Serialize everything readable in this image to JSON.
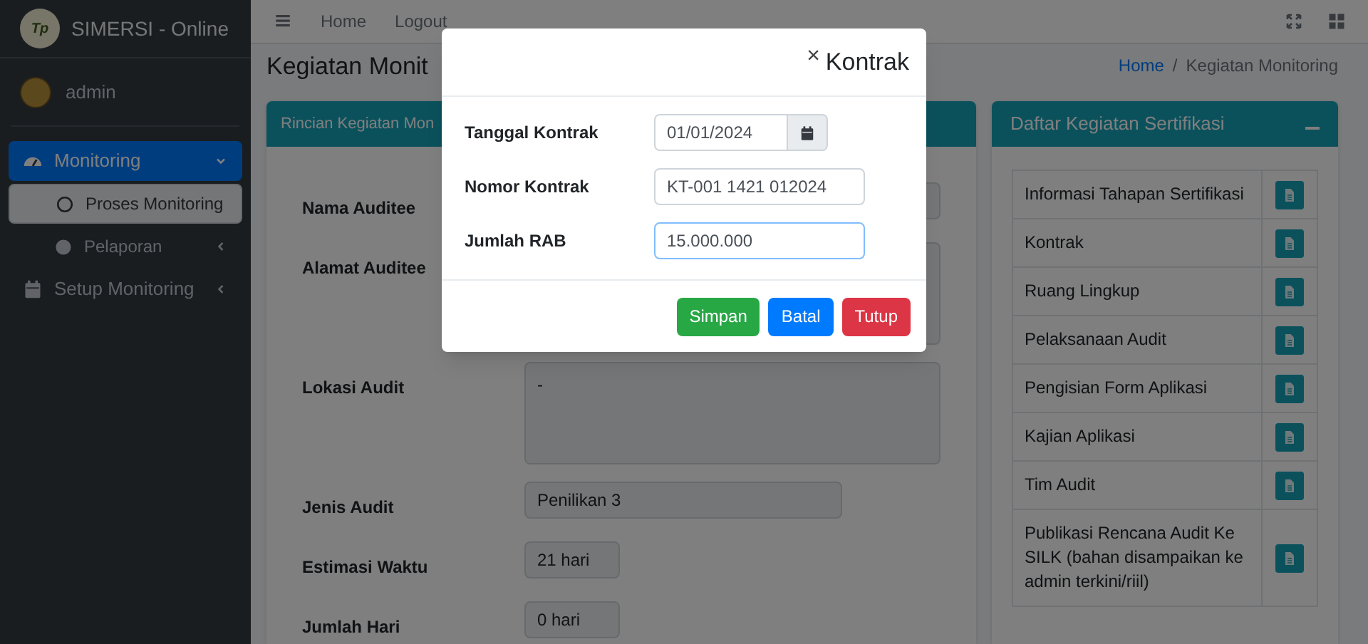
{
  "brand": {
    "title": "SIMERSI - Online",
    "logo_text": "Tp"
  },
  "user": {
    "name": "admin"
  },
  "sidebar": {
    "items": [
      {
        "label": "Monitoring",
        "selected": true,
        "expanded": true,
        "children": [
          {
            "label": "Proses Monitoring",
            "selected": true
          },
          {
            "label": "Pelaporan",
            "selected": false,
            "has_submenu": true
          }
        ]
      },
      {
        "label": "Setup Monitoring",
        "selected": false,
        "expanded": false
      }
    ]
  },
  "navbar": {
    "links": [
      "Home",
      "Logout"
    ]
  },
  "page": {
    "title": "Kegiatan Monit",
    "breadcrumb": [
      {
        "label": "Home",
        "link": true
      },
      {
        "label": "Kegiatan Monitoring",
        "link": false
      }
    ],
    "breadcrumb_separator": "/"
  },
  "detail_card": {
    "title": "Rincian Kegiatan Mon",
    "fields": [
      {
        "label": "Nama Auditee",
        "kind": "text"
      },
      {
        "label": "Alamat Auditee",
        "kind": "textarea"
      },
      {
        "label": "Lokasi Audit",
        "kind": "textarea",
        "value": "-"
      },
      {
        "label": "Jenis Audit",
        "kind": "text",
        "value": "Penilikan 3"
      },
      {
        "label": "Estimasi Waktu",
        "kind": "text",
        "value": "21 hari"
      },
      {
        "label": "Jumlah Hari",
        "kind": "text",
        "value": "0 hari"
      }
    ]
  },
  "activity_card": {
    "title": "Daftar Kegiatan Sertifikasi",
    "items": [
      "Informasi Tahapan Sertifikasi",
      "Kontrak",
      "Ruang Lingkup",
      "Pelaksanaan Audit",
      "Pengisian Form Aplikasi",
      "Kajian Aplikasi",
      "Tim Audit",
      "Publikasi Rencana Audit Ke SILK (bahan disampaikan ke admin terkini/riil)"
    ]
  },
  "modal": {
    "close": "×",
    "title": "Kontrak",
    "fields": [
      {
        "label": "Tanggal Kontrak",
        "kind": "date",
        "value": "01/01/2024",
        "focused": false
      },
      {
        "label": "Nomor Kontrak",
        "kind": "text",
        "value": "KT-001 1421 012024",
        "focused": false
      },
      {
        "label": "Jumlah RAB",
        "kind": "text",
        "value": "15.000.000",
        "focused": true
      }
    ],
    "buttons": [
      "Simpan",
      "Batal",
      "Tutup"
    ]
  }
}
